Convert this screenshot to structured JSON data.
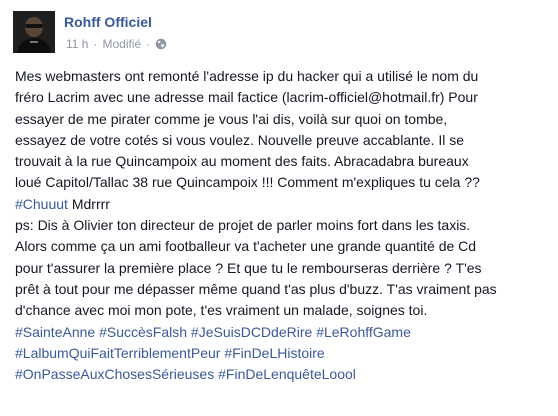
{
  "post": {
    "author": "Rohff Officiel",
    "time": "11 h",
    "separator1": "·",
    "edited": "Modifié",
    "separator2": "·",
    "privacy_icon": "globe-icon",
    "link_color": "#3b5998",
    "meta_color": "#9197a3",
    "lines": [
      [
        {
          "t": "Mes webmasters ont remonté l'adresse ip du hacker qui a utilisé le nom du"
        }
      ],
      [
        {
          "t": "fréro Lacrim avec une adresse mail factice (lacrim-officiel@hotmail.fr) Pour"
        }
      ],
      [
        {
          "t": "essayer de me pirater comme je vous l'ai dis, voilà sur quoi on tombe,"
        }
      ],
      [
        {
          "t": "essayez de votre cotés si vous voulez. Nouvelle preuve accablante. Il se"
        }
      ],
      [
        {
          "t": "trouvait à la rue Quincampoix au moment des faits. Abracadabra bureaux"
        }
      ],
      [
        {
          "t": "loué Capitol/Tallac 38 rue Quincampoix !!! Comment m'expliques tu cela ??"
        }
      ],
      [
        {
          "t": "#Chuuut",
          "tag": true
        },
        {
          "t": " Mdrrrr"
        }
      ],
      [
        {
          "t": "ps: Dis à Olivier ton directeur de projet de parler moins fort dans les taxis."
        }
      ],
      [
        {
          "t": "Alors comme ça un ami footballeur va t'acheter une grande quantité de Cd"
        }
      ],
      [
        {
          "t": "pour t'assurer la première place ? Et que tu le rembourseras derrière ? T'es"
        }
      ],
      [
        {
          "t": "prêt à tout pour me dépasser même quand t'as plus d'buzz. T'as vraiment pas"
        }
      ],
      [
        {
          "t": "d'chance avec moi mon pote, t'es vraiment un malade, soignes toi."
        }
      ],
      [
        {
          "t": "#SainteAnne",
          "tag": true
        },
        {
          "t": " "
        },
        {
          "t": "#SuccèsFalsh",
          "tag": true
        },
        {
          "t": " "
        },
        {
          "t": "#JeSuisDCDdeRire",
          "tag": true
        },
        {
          "t": " "
        },
        {
          "t": "#LeRohffGame",
          "tag": true
        }
      ],
      [
        {
          "t": "#LalbumQuiFaitTerriblementPeur",
          "tag": true
        },
        {
          "t": " "
        },
        {
          "t": "#FinDeLHistoire",
          "tag": true
        }
      ],
      [
        {
          "t": "#OnPasseAuxChosesSérieuses",
          "tag": true
        },
        {
          "t": " "
        },
        {
          "t": "#FinDeLenquêteLoool",
          "tag": true
        }
      ]
    ]
  }
}
